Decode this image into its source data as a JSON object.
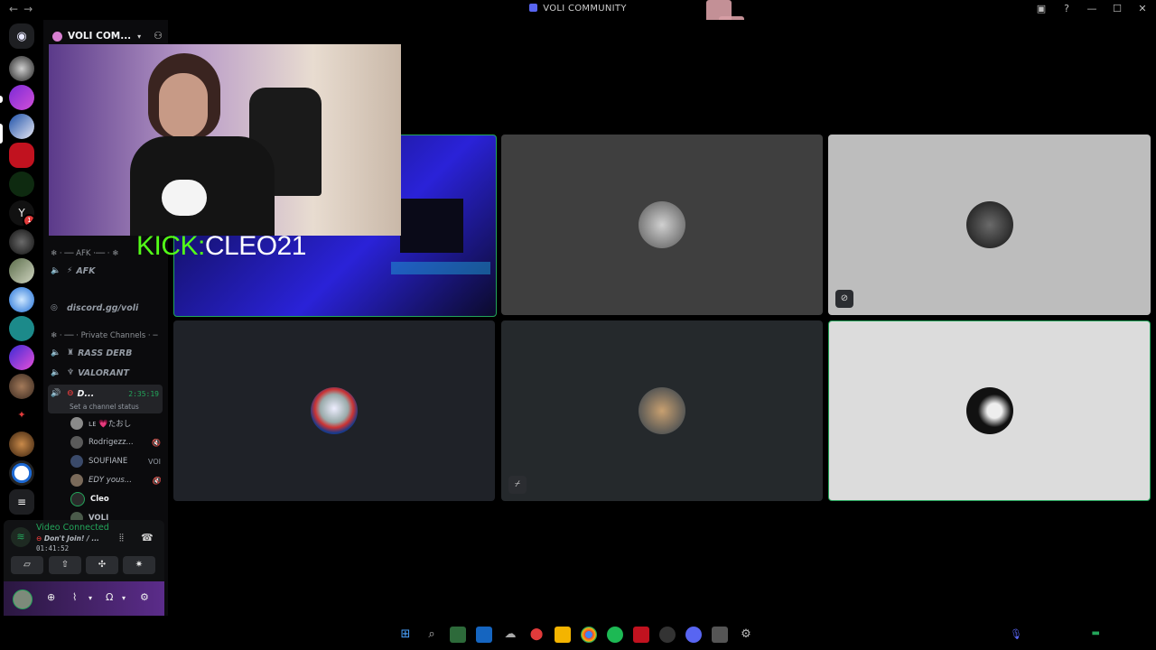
{
  "window": {
    "title": "VOLI COMMUNITY",
    "back_icon": "back-arrow-icon",
    "forward_icon": "forward-arrow-icon"
  },
  "guild_bar": {
    "items": [
      {
        "name": "home",
        "icon": "discord-icon"
      },
      {
        "name": "server-1",
        "badge": ""
      },
      {
        "name": "cleo-server",
        "badge": ""
      },
      {
        "name": "server-3",
        "badge": ""
      },
      {
        "name": "server-4",
        "badge": ""
      },
      {
        "name": "server-5",
        "badge": ""
      },
      {
        "name": "yeah-server",
        "badge": "1"
      },
      {
        "name": "server-7",
        "badge": ""
      },
      {
        "name": "server-8",
        "badge": ""
      },
      {
        "name": "server-9",
        "badge": ""
      },
      {
        "name": "stake-server",
        "badge": ""
      },
      {
        "name": "server-11",
        "badge": ""
      },
      {
        "name": "server-12",
        "badge": ""
      },
      {
        "name": "server-13",
        "badge": ""
      },
      {
        "name": "server-14",
        "badge": ""
      },
      {
        "name": "bmw-server",
        "badge": ""
      },
      {
        "name": "server-16",
        "badge": ""
      }
    ]
  },
  "server": {
    "name": "VOLI COM...",
    "categories": {
      "afk": "❄ · ── AFK ·── · ❄",
      "private": "❄ · ── · Private Channels · ─"
    },
    "channels": {
      "afk": "AFK",
      "invite": "discord.gg/voli",
      "rass_derb": "RASS DERB",
      "valorant": "VALORANT",
      "active": "D...",
      "active_timer": "2:35:19",
      "channel_status": "Set a channel status"
    },
    "voice_users": [
      {
        "name": "ʟᴇ 💗たおし",
        "right": ""
      },
      {
        "name": "Rodrigezz...",
        "right": "🔇"
      },
      {
        "name": "SOUFIANE",
        "right": "VOI"
      },
      {
        "name": "EDY yous...",
        "right": "🔇"
      },
      {
        "name": "Cleo",
        "right": ""
      },
      {
        "name": "VOLI",
        "right": ""
      }
    ]
  },
  "voice_connection": {
    "status": "Video Connected",
    "channel": "Don't Join! / ...",
    "elapsed": "01:41:52",
    "buttons": [
      "camera-off-icon",
      "screen-share-icon",
      "activities-icon",
      "soundboard-icon"
    ]
  },
  "user_panel": {
    "icons": [
      "gamepad-icon",
      "mute-mic-icon",
      "headphones-icon",
      "settings-icon"
    ]
  },
  "stream_overlay": {
    "prefix": "KICK:",
    "handle": "CLEO21",
    "prefix_color": "#53fc18",
    "handle_color": "#ffffff"
  },
  "video_grid": {
    "tiles": [
      {
        "name": "tile-streamer-cam",
        "bg": "#1b1f8a",
        "speaking": true
      },
      {
        "name": "tile-user-2",
        "bg": "#3f3f3f",
        "avatar": "#8a8a8a"
      },
      {
        "name": "tile-user-3",
        "bg": "#bdbdbd",
        "avatar": "#2a2a2a",
        "badge": "camera-off-icon"
      },
      {
        "name": "tile-user-4",
        "bg": "#1f2228",
        "avatar": "#c0c6d6"
      },
      {
        "name": "tile-user-5",
        "bg": "#25292c",
        "avatar": "#9a7a52",
        "badge": "mic-off-icon"
      },
      {
        "name": "tile-user-6",
        "bg": "#dcdcdc",
        "avatar": "#222222",
        "speaking": true
      }
    ]
  },
  "taskbar": {
    "icons": [
      "windows-start-icon",
      "search-icon",
      "app-icon",
      "mail-icon",
      "app-icon",
      "maps-icon",
      "file-explorer-icon",
      "chrome-icon",
      "spotify-icon",
      "app-icon",
      "app-icon",
      "discord-icon",
      "chrome-icon",
      "settings-icon"
    ]
  }
}
